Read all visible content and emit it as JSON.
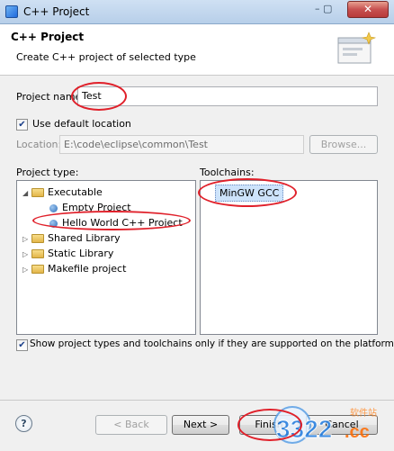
{
  "window": {
    "title": "C++ Project",
    "close_glyph": "✕",
    "minmax_glyph": "–  ▢"
  },
  "header": {
    "title": "C++ Project",
    "description": "Create C++ project of selected type"
  },
  "form": {
    "project_name_label": "Project name:",
    "project_name_value": "Test",
    "use_default_location": {
      "checked": true,
      "label": "Use default location"
    },
    "location_label": "Location:",
    "location_value": "E:\\code\\eclipse\\common\\Test",
    "browse_label": "Browse..."
  },
  "project_type": {
    "heading": "Project type:",
    "items": [
      {
        "label": "Executable",
        "expanded": true,
        "icon": "folder-icon"
      },
      {
        "label": "Empty Project",
        "icon": "bullet-icon"
      },
      {
        "label": "Hello World C++ Project",
        "icon": "bullet-icon",
        "selected": true
      },
      {
        "label": "Shared Library",
        "icon": "folder-icon"
      },
      {
        "label": "Static Library",
        "icon": "folder-icon"
      },
      {
        "label": "Makefile project",
        "icon": "folder-icon"
      }
    ]
  },
  "toolchains": {
    "heading": "Toolchains:",
    "items": [
      {
        "label": "MinGW GCC",
        "selected": true
      }
    ]
  },
  "filter": {
    "checked": true,
    "label": "Show project types and toolchains only if they are supported on the platform"
  },
  "footer": {
    "help_glyph": "?",
    "back_label": "< Back",
    "next_label": "Next >",
    "finish_label": "Finish",
    "cancel_label": "Cancel"
  },
  "watermark": {
    "text": "3322.cc",
    "subtext": "软件站"
  },
  "colors": {
    "annotation": "#e0202a",
    "selection": "#3399ff"
  }
}
